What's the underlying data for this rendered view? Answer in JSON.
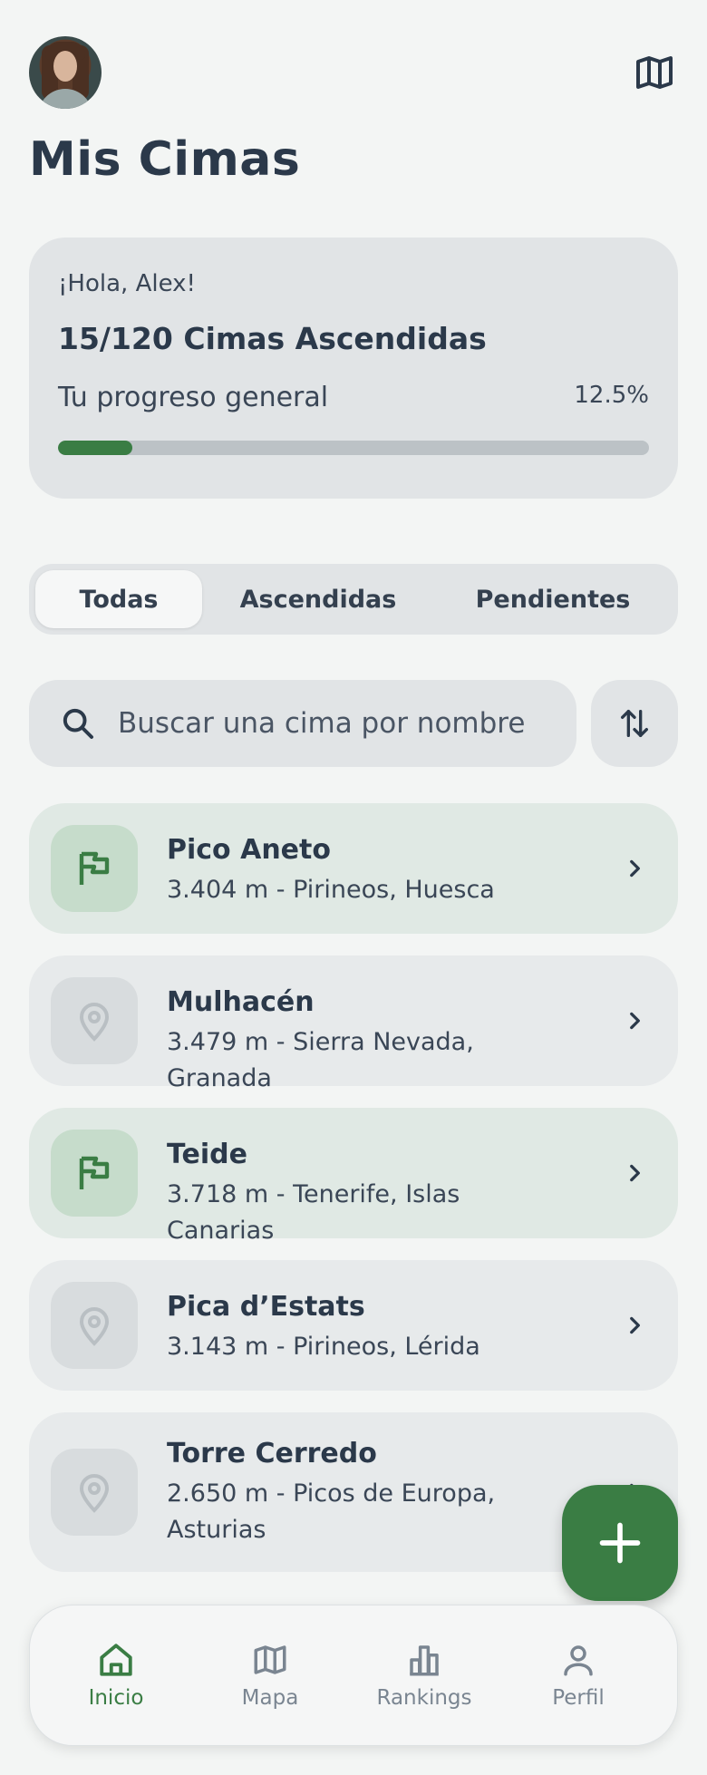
{
  "header": {
    "title": "Mis Cimas"
  },
  "progress": {
    "greeting": "¡Hola, Alex!",
    "count_label": "15/120 Cimas Ascendidas",
    "progress_label": "Tu progreso general",
    "percent_label": "12.5%",
    "fraction": 0.125
  },
  "tabs": [
    {
      "label": "Todas",
      "selected": true
    },
    {
      "label": "Ascendidas",
      "selected": false
    },
    {
      "label": "Pendientes",
      "selected": false
    }
  ],
  "search": {
    "placeholder": "Buscar una cima por nombre",
    "value": ""
  },
  "peaks": [
    {
      "name": "Pico Aneto",
      "meta": "3.404 m - Pirineos, Huesca",
      "status": "climbed",
      "icon": "flag-icon"
    },
    {
      "name": "Mulhacén",
      "meta": "3.479 m - Sierra Nevada, Granada",
      "status": "pending",
      "icon": "map-pin-icon"
    },
    {
      "name": "Teide",
      "meta": "3.718 m - Tenerife, Islas Canarias",
      "status": "climbed",
      "icon": "flag-icon"
    },
    {
      "name": "Pica d’Estats",
      "meta": "3.143 m - Pirineos, Lérida",
      "status": "pending",
      "icon": "map-pin-icon"
    },
    {
      "name": "Torre Cerredo",
      "meta": "2.650 m - Picos de Europa, Asturias",
      "status": "pending",
      "icon": "map-pin-icon"
    }
  ],
  "nav": [
    {
      "label": "Inicio",
      "icon": "home-icon",
      "active": true
    },
    {
      "label": "Mapa",
      "icon": "map-icon",
      "active": false
    },
    {
      "label": "Rankings",
      "icon": "rankings-icon",
      "active": false
    },
    {
      "label": "Perfil",
      "icon": "profile-icon",
      "active": false
    }
  ],
  "colors": {
    "accent": "#3a7d44",
    "text": "#2b394a",
    "card": "#e1e4e6",
    "climbed_card": "#e0e9e4",
    "inactive_nav": "#7a8591"
  }
}
